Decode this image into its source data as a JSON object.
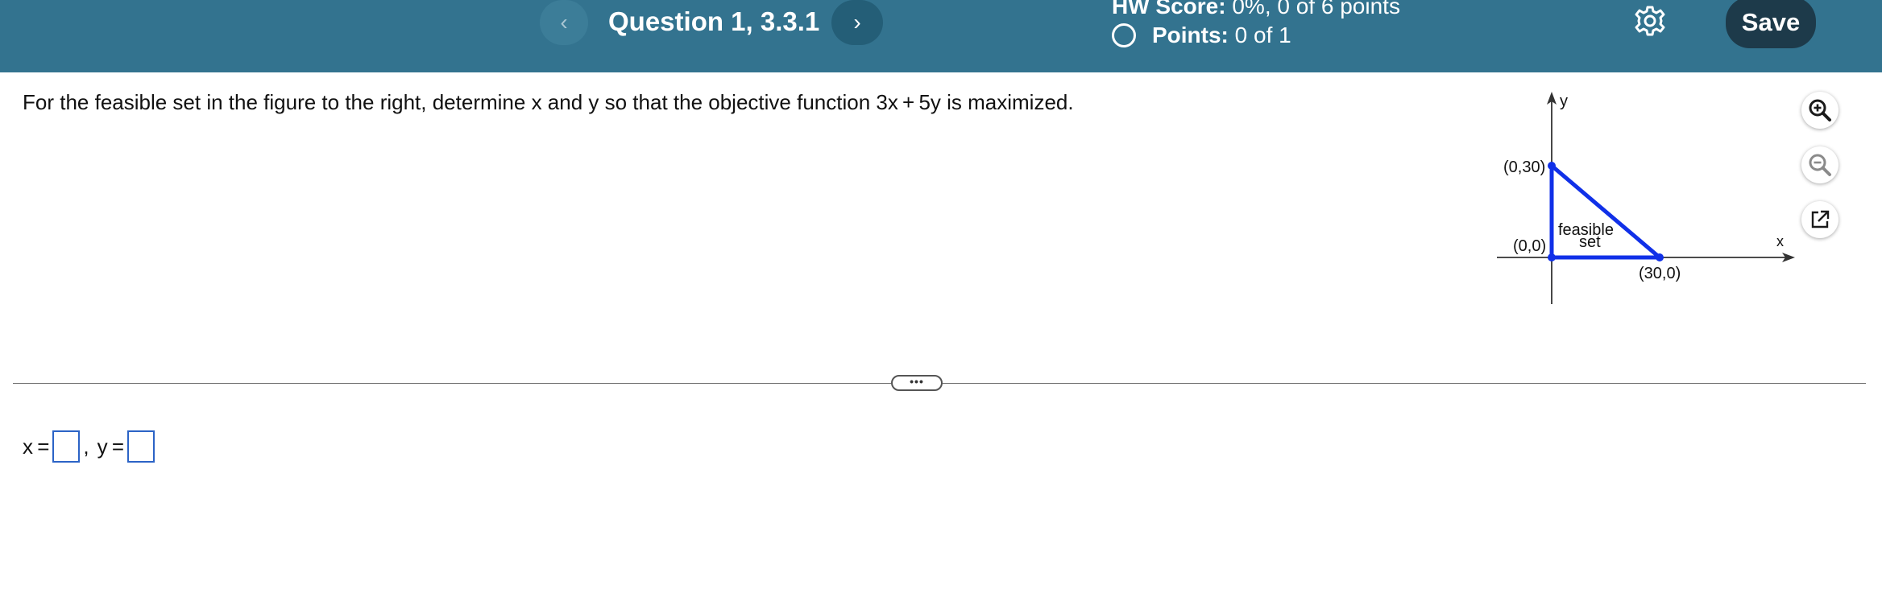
{
  "header": {
    "prev_icon": "chevron-left-icon",
    "prev_glyph": "‹",
    "title": "Question 1, 3.3.1",
    "next_icon": "chevron-right-icon",
    "next_glyph": "›",
    "hw_score_label": "HW Score:",
    "hw_score_value": "0%, 0 of 6 points",
    "points_label": "Points:",
    "points_value": "0 of 1",
    "settings_icon": "gear-icon",
    "save_label": "Save",
    "background_color": "#33738f",
    "save_color": "#1d3a4a"
  },
  "question": {
    "text": "For the feasible set in the figure to the right, determine x and y so that the objective function 3x + 5y is maximized."
  },
  "figure": {
    "y_axis_label": "y",
    "x_axis_label": "x",
    "vertex_top_label": "(0,30)",
    "vertex_origin_label": "(0,0)",
    "vertex_right_label": "(30,0)",
    "region_label_line1": "feasible",
    "region_label_line2": "set",
    "vertices": [
      [
        0,
        0
      ],
      [
        0,
        30
      ],
      [
        30,
        0
      ]
    ],
    "line_color": "#1030e8"
  },
  "tools": {
    "zoom_in_icon": "zoom-in-icon",
    "zoom_out_icon": "zoom-out-icon",
    "popout_icon": "external-link-icon"
  },
  "divider": {
    "handle_glyph": "•••"
  },
  "answer": {
    "x_label": "x =",
    "separator": ",",
    "y_label": "y =",
    "x_value": "",
    "y_value": ""
  }
}
